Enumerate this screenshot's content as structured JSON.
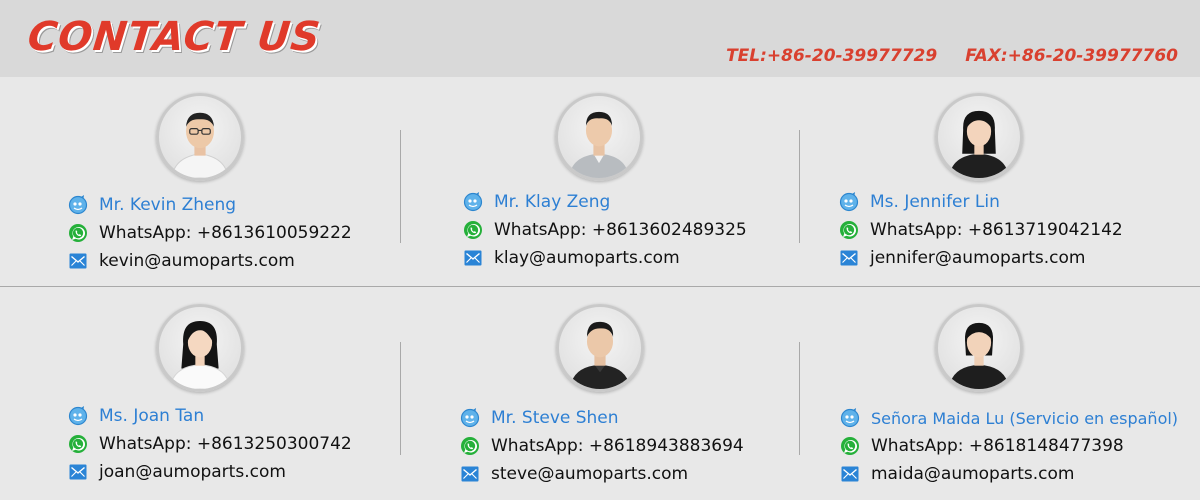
{
  "header": {
    "title": "CONTACT US",
    "tel": "TEL:+86-20-39977729",
    "fax": "FAX:+86-20-39977760"
  },
  "contacts": [
    {
      "name": "Mr. Kevin Zheng",
      "whatsapp": "WhatsApp: +8613610059222",
      "email": "kevin@aumoparts.com",
      "avatar": "man-with-glasses-white-shirt"
    },
    {
      "name": "Mr. Klay Zeng",
      "whatsapp": "WhatsApp: +8613602489325",
      "email": "klay@aumoparts.com",
      "avatar": "man-grey-shirt"
    },
    {
      "name": "Ms. Jennifer Lin",
      "whatsapp": "WhatsApp: +8613719042142",
      "email": "jennifer@aumoparts.com",
      "avatar": "woman-black-top"
    },
    {
      "name": "Ms. Joan Tan",
      "whatsapp": "WhatsApp: +8613250300742",
      "email": "joan@aumoparts.com",
      "avatar": "woman-white-blouse"
    },
    {
      "name": "Mr. Steve Shen",
      "whatsapp": "WhatsApp: +8618943883694",
      "email": "steve@aumoparts.com",
      "avatar": "man-black-shirt"
    },
    {
      "name": "Señora Maida Lu (Servicio en español)",
      "whatsapp": "WhatsApp: +8618148477398",
      "email": "maida@aumoparts.com",
      "avatar": "woman-black-shirt"
    }
  ],
  "colors": {
    "title_red": "#e03a2a",
    "name_blue": "#2d7fd3",
    "whatsapp_green": "#25b03a",
    "mail_blue": "#2a84d6"
  },
  "icons": {
    "name": "chat-bubble-icon",
    "whatsapp": "whatsapp-icon",
    "email": "envelope-icon"
  }
}
